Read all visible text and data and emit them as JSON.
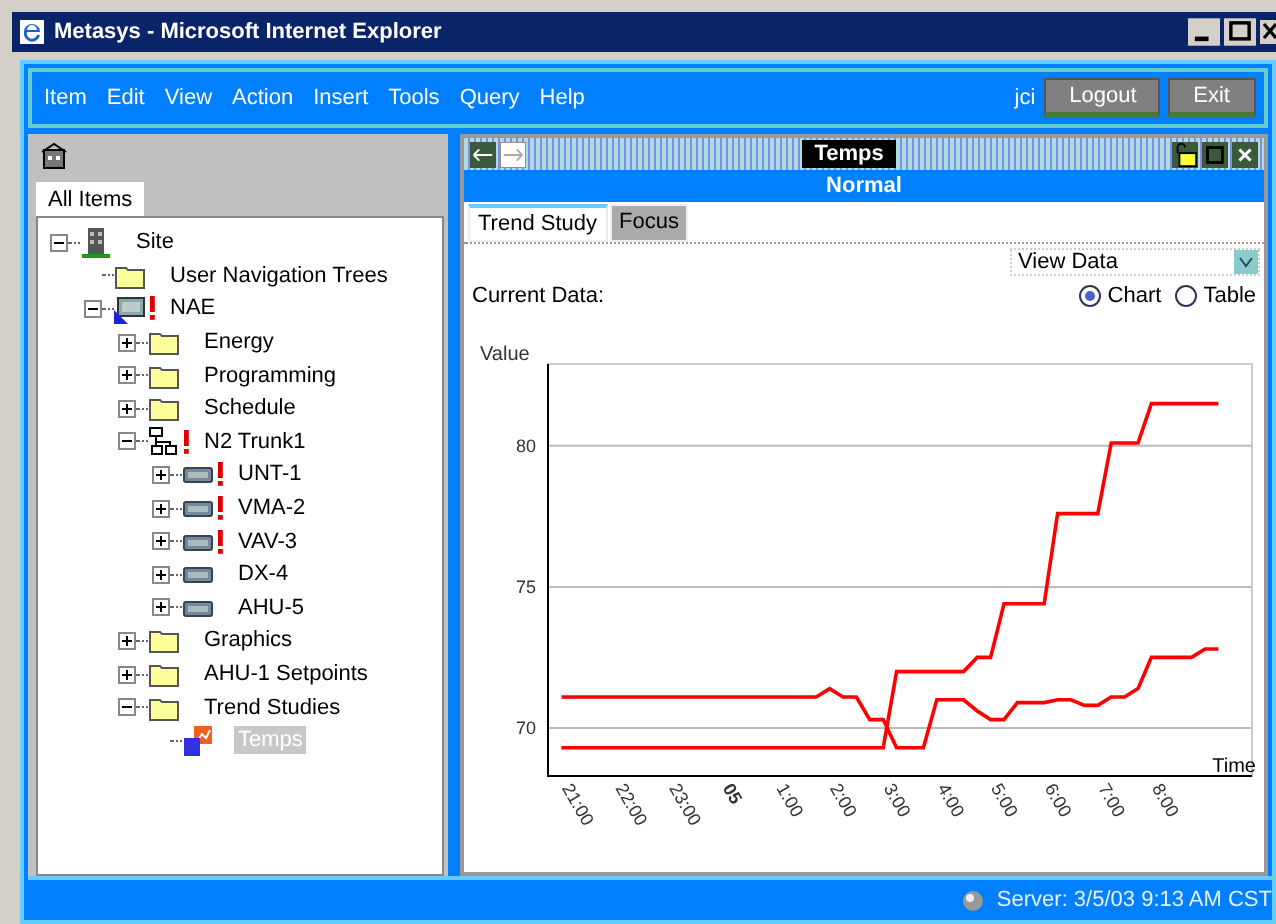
{
  "window": {
    "title": "Metasys - Microsoft Internet Explorer"
  },
  "menu": [
    "Item",
    "Edit",
    "View",
    "Action",
    "Insert",
    "Tools",
    "Query",
    "Help"
  ],
  "user": "jci",
  "header_buttons": [
    "Logout",
    "Exit"
  ],
  "nav": {
    "tabs": [
      {
        "label": "All Items",
        "selected": true
      }
    ],
    "tree": [
      {
        "label": "Site",
        "kind": "building",
        "expanded": true,
        "alarm": false,
        "selected": false,
        "children": [
          {
            "label": "User Navigation Trees",
            "kind": "folder",
            "alarm": false,
            "selected": false
          },
          {
            "label": "NAE",
            "kind": "controller",
            "expanded": true,
            "alarm": true,
            "selected": false,
            "children": [
              {
                "label": "Energy",
                "kind": "folder",
                "expanded": false,
                "alarm": false,
                "selected": false
              },
              {
                "label": "Programming",
                "kind": "folder",
                "expanded": false,
                "alarm": false,
                "selected": false
              },
              {
                "label": "Schedule",
                "kind": "folder",
                "expanded": false,
                "alarm": false,
                "selected": false
              },
              {
                "label": "N2 Trunk1",
                "kind": "network",
                "expanded": true,
                "alarm": true,
                "selected": false,
                "children": [
                  {
                    "label": "UNT-1",
                    "kind": "device",
                    "expanded": false,
                    "alarm": true,
                    "selected": false
                  },
                  {
                    "label": "VMA-2",
                    "kind": "device",
                    "expanded": false,
                    "alarm": true,
                    "selected": false
                  },
                  {
                    "label": "VAV-3",
                    "kind": "device",
                    "expanded": false,
                    "alarm": true,
                    "selected": false
                  },
                  {
                    "label": "DX-4",
                    "kind": "device",
                    "expanded": false,
                    "alarm": false,
                    "selected": false
                  },
                  {
                    "label": "AHU-5",
                    "kind": "device",
                    "expanded": false,
                    "alarm": false,
                    "selected": false
                  }
                ]
              },
              {
                "label": "Graphics",
                "kind": "folder",
                "expanded": false,
                "alarm": false,
                "selected": false
              },
              {
                "label": "AHU-1 Setpoints",
                "kind": "folder",
                "expanded": false,
                "alarm": false,
                "selected": false
              },
              {
                "label": "Trend Studies",
                "kind": "folder",
                "expanded": true,
                "alarm": false,
                "selected": false,
                "children": [
                  {
                    "label": "Temps",
                    "kind": "trend",
                    "alarm": false,
                    "selected": true
                  }
                ]
              }
            ]
          }
        ]
      }
    ]
  },
  "panel": {
    "title": "Temps",
    "status": "Normal",
    "tabs": [
      {
        "label": "Trend Study",
        "selected": true
      },
      {
        "label": "Focus",
        "selected": false
      }
    ],
    "view_select": "View Data",
    "current_label": "Current Data:",
    "view_modes": [
      {
        "label": "Chart",
        "selected": true
      },
      {
        "label": "Table",
        "selected": false
      }
    ],
    "chart_data": {
      "type": "line",
      "xlabel": "Time",
      "ylabel": "Value",
      "categories": [
        "21:00",
        null,
        null,
        null,
        "22:00",
        null,
        null,
        null,
        "23:00",
        null,
        null,
        null,
        "05",
        null,
        null,
        null,
        "1:00",
        null,
        null,
        null,
        "2:00",
        null,
        null,
        null,
        "3:00",
        null,
        null,
        null,
        "4:00",
        null,
        null,
        null,
        "5:00",
        null,
        null,
        null,
        "6:00",
        null,
        null,
        null,
        "7:00",
        null,
        null,
        null,
        "8:00",
        null,
        null,
        null,
        null,
        null
      ],
      "series": [
        {
          "color": "#ff0000",
          "values": [
            69.3,
            69.3,
            69.3,
            69.3,
            69.3,
            69.3,
            69.3,
            69.3,
            69.3,
            69.3,
            69.3,
            69.3,
            69.3,
            69.3,
            69.3,
            69.3,
            69.3,
            69.3,
            69.3,
            69.3,
            69.3,
            69.3,
            69.3,
            69.3,
            69.3,
            72.0,
            72.0,
            72.0,
            72.0,
            72.0,
            72.0,
            72.5,
            72.5,
            74.4,
            74.4,
            74.4,
            74.4,
            77.6,
            77.6,
            77.6,
            77.6,
            80.1,
            80.1,
            80.1,
            81.5,
            81.5,
            81.5,
            81.5,
            81.5,
            81.5
          ]
        },
        {
          "color": "#ff0000",
          "values": [
            71.1,
            71.1,
            71.1,
            71.1,
            71.1,
            71.1,
            71.1,
            71.1,
            71.1,
            71.1,
            71.1,
            71.1,
            71.1,
            71.1,
            71.1,
            71.1,
            71.1,
            71.1,
            71.1,
            71.1,
            71.4,
            71.1,
            71.1,
            70.3,
            70.3,
            69.3,
            69.3,
            69.3,
            71.0,
            71.0,
            71.0,
            70.6,
            70.3,
            70.3,
            70.9,
            70.9,
            70.9,
            71.0,
            71.0,
            70.8,
            70.8,
            71.1,
            71.1,
            71.4,
            72.5,
            72.5,
            72.5,
            72.5,
            72.8,
            72.8
          ]
        }
      ],
      "ylim": [
        68.3,
        82.9
      ],
      "yticks": [
        70,
        75,
        80
      ],
      "grid": true
    }
  },
  "status_bar": "Server: 3/5/03 9:13 AM CST"
}
